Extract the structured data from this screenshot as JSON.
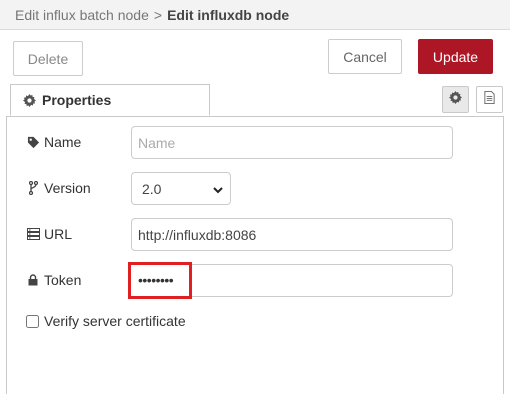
{
  "breadcrumb": {
    "parent": "Edit influx batch node",
    "separator": ">",
    "current": "Edit influxdb node"
  },
  "toolbar": {
    "delete_label": "Delete",
    "cancel_label": "Cancel",
    "update_label": "Update"
  },
  "tabs": {
    "properties_label": "Properties"
  },
  "form": {
    "name_label": "Name",
    "name_value": "",
    "name_placeholder": "Name",
    "version_label": "Version",
    "version_value": "2.0",
    "url_label": "URL",
    "url_value": "http://influxdb:8086",
    "token_label": "Token",
    "token_value": "••••••••",
    "verify_label": "Verify server certificate",
    "verify_checked": false
  },
  "colors": {
    "update_button": "#ad1625",
    "highlight_border": "#e02020"
  },
  "icons": [
    "cog-icon",
    "file-text-icon",
    "tag-icon",
    "code-fork-icon",
    "server-icon",
    "lock-icon",
    "chevron-down-icon"
  ]
}
